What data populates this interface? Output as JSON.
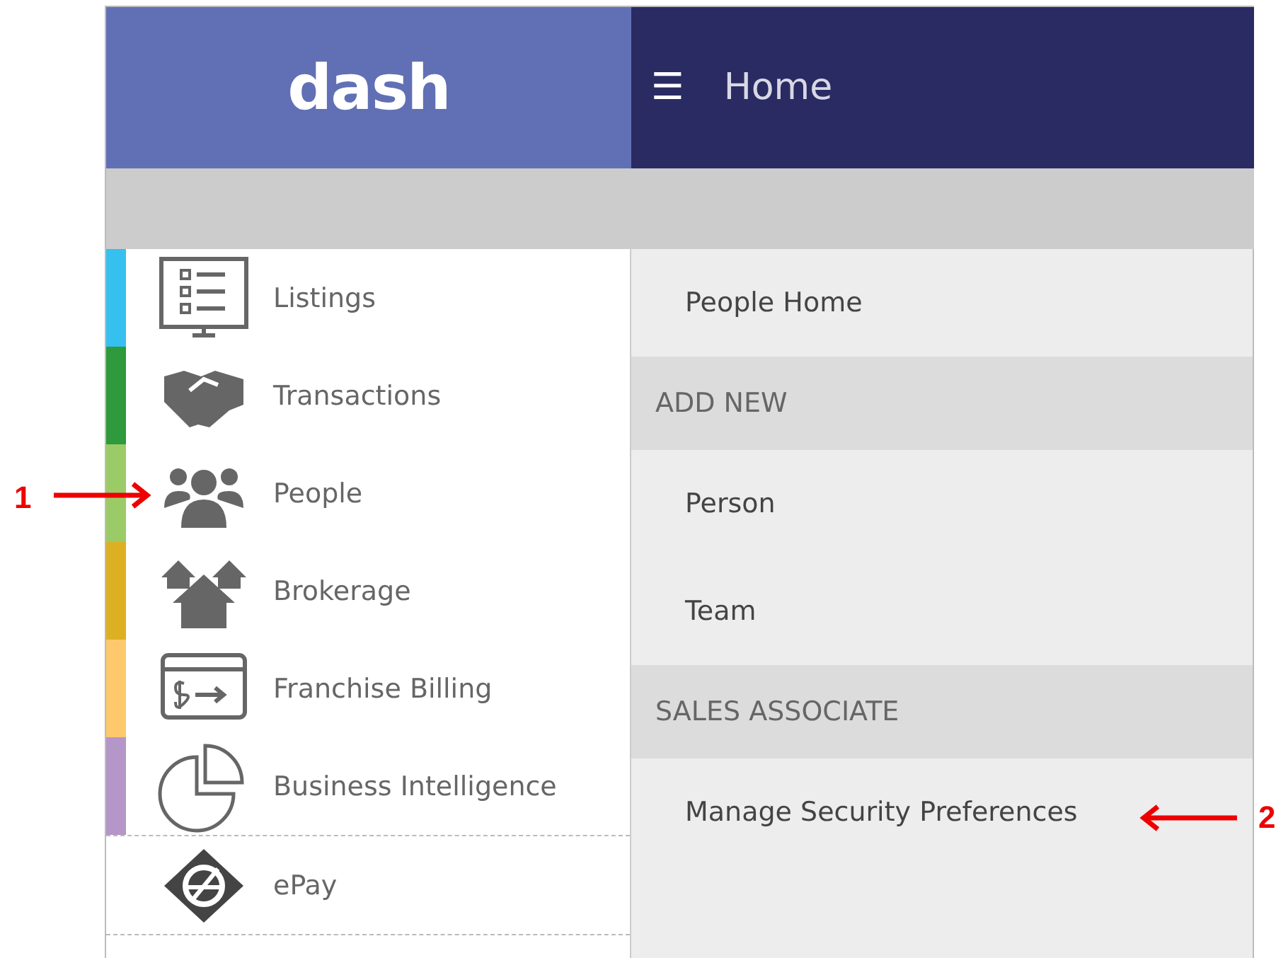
{
  "header": {
    "logo": "dash",
    "menu_glyph": "☰",
    "title": "Home"
  },
  "sidebar": {
    "items": [
      {
        "label": "Listings",
        "kind": "module",
        "color": "#35c0ef"
      },
      {
        "label": "Transactions",
        "kind": "module",
        "color": "#2e9a3b"
      },
      {
        "label": "People",
        "kind": "module",
        "color": "#9bcb67"
      },
      {
        "label": "Brokerage",
        "kind": "module",
        "color": "#ddb023"
      },
      {
        "label": "Franchise Billing",
        "kind": "module",
        "color": "#fdc96c"
      },
      {
        "label": "Business Intelligence",
        "kind": "module",
        "color": "#b496c8"
      },
      {
        "label": "ePay",
        "kind": "extra"
      }
    ]
  },
  "submenu": {
    "items": [
      {
        "label": "People Home",
        "kind": "link"
      },
      {
        "label": "ADD NEW",
        "kind": "header"
      },
      {
        "label": "Person",
        "kind": "link"
      },
      {
        "label": "Team",
        "kind": "link"
      },
      {
        "label": "SALES ASSOCIATE",
        "kind": "header"
      },
      {
        "label": "Manage Security Preferences",
        "kind": "link"
      }
    ]
  },
  "annotations": [
    {
      "label": "1",
      "kind": "left"
    },
    {
      "label": "2",
      "kind": "right"
    }
  ]
}
